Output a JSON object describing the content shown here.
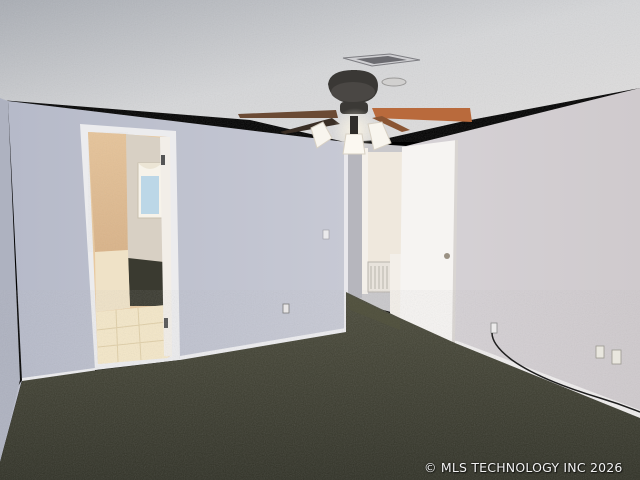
{
  "watermark": {
    "text": "© MLS TECHNOLOGY INC 2026"
  },
  "colors": {
    "ceiling": "#d6d7d9",
    "left_wall": "#b9bdcc",
    "back_wall": "#c2c5d2",
    "right_wall": "#d4d1d4",
    "carpet": "#3c3d30",
    "door": "#f6f4f2",
    "fan_blade": "#b96a3c",
    "wallpaper": "#e2bf94",
    "tile_floor": "#f4e7c8"
  },
  "icons": [
    "ceiling-fan-icon",
    "air-vent-icon",
    "smoke-detector-icon",
    "power-outlet-icon"
  ]
}
